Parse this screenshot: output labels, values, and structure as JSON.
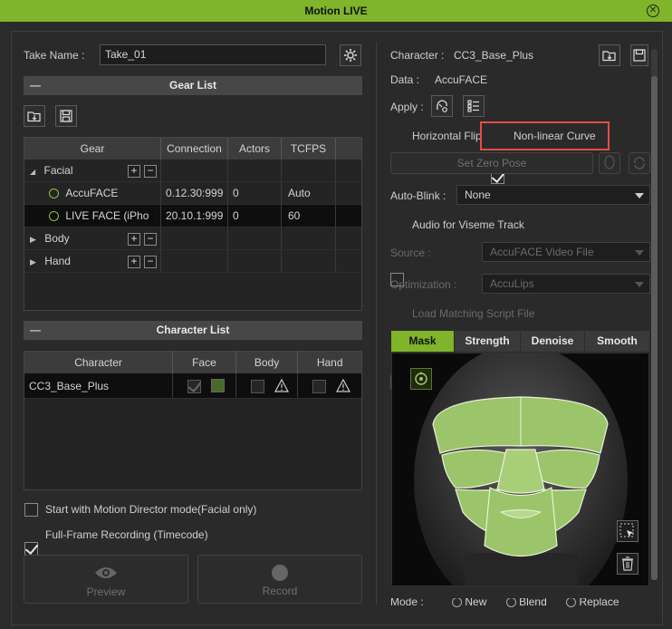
{
  "window": {
    "title": "Motion LIVE"
  },
  "take": {
    "label": "Take Name :",
    "value": "Take_01"
  },
  "gear_list": {
    "title": "Gear List",
    "columns": [
      "Gear",
      "Connection",
      "Actors",
      "TCFPS"
    ],
    "groups": {
      "facial": "Facial",
      "body": "Body",
      "hand": "Hand"
    },
    "devices": [
      {
        "name": "AccuFACE",
        "connection": "0.12.30:999",
        "actors": "0",
        "tcfps": "Auto"
      },
      {
        "name": "LIVE FACE (iPho",
        "connection": "20.10.1:999",
        "actors": "0",
        "tcfps": "60"
      }
    ]
  },
  "character_list": {
    "title": "Character List",
    "columns": [
      "Character",
      "Face",
      "Body",
      "Hand"
    ],
    "rows": [
      {
        "name": "CC3_Base_Plus"
      }
    ]
  },
  "options": {
    "motion_director": "Start with Motion Director mode(Facial only)",
    "full_frame": "Full-Frame Recording (Timecode)"
  },
  "buttons": {
    "preview": "Preview",
    "record": "Record"
  },
  "right": {
    "character_label": "Character :",
    "character_value": "CC3_Base_Plus",
    "data_label": "Data :",
    "data_value": "AccuFACE",
    "apply_label": "Apply :",
    "horizontal_flip": "Horizontal Flip",
    "nonlinear_curve": "Non-linear Curve",
    "set_zero_pose": "Set Zero Pose",
    "auto_blink_label": "Auto-Blink :",
    "auto_blink_value": "None",
    "audio_viseme": "Audio for Viseme Track",
    "source_label": "Source :",
    "source_value": "AccuFACE Video File",
    "optimization_label": "Optimization :",
    "optimization_value": "AccuLips",
    "load_script": "Load Matching Script File",
    "tabs": [
      "Mask",
      "Strength",
      "Denoise",
      "Smooth"
    ],
    "mode_label": "Mode :",
    "modes": [
      "New",
      "Blend",
      "Replace"
    ]
  },
  "colors": {
    "accent": "#80b42a",
    "highlight": "#e84a4a",
    "mask": "#9cc46a"
  }
}
